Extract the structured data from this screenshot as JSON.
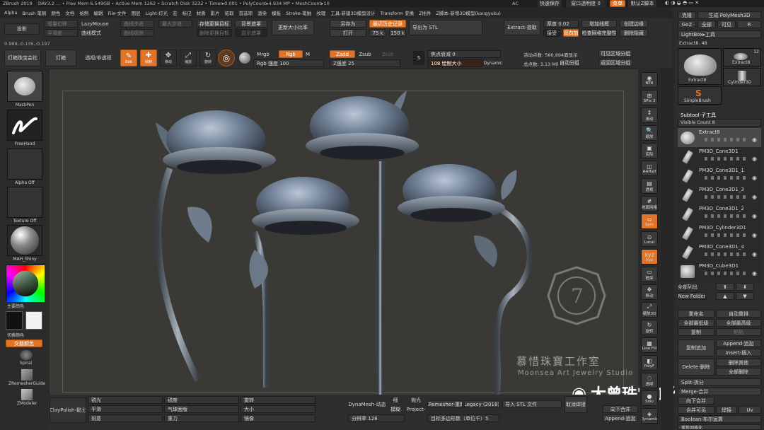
{
  "menubar": {
    "app_title": "ZBrush 2019",
    "info": "DAY3.2 … • Free Mem 6.549GB • Active Mem 1262 • Scratch Disk 3232 • Timer▸0.001 • PolyCount▸4.934 MP • MeshCount▸10",
    "ac": "AC",
    "quicksave": "快速保存",
    "transparency": "窗口透明度 0",
    "menu_btn": "菜单",
    "default_script": "默认Z脚本",
    "items": [
      "Alpha",
      "Brush 笔刷",
      "颜色",
      "文档",
      "绘制",
      "编辑",
      "File-文件",
      "图层",
      "Light-灯光",
      "宏",
      "标记",
      "材质",
      "影片",
      "拓取",
      "首选项",
      "渲染",
      "模板",
      "Stroke-笔触",
      "纹理",
      "工具-新建3D模型设计",
      "Transform 变换",
      "Z插件",
      "Z脚本-新增3D模型(kongyuku)"
    ]
  },
  "toolbar": {
    "projection": "投影",
    "lazymouse": "LazyMouse",
    "curve_mode": "曲线模式",
    "save_brush": "存储更换目标",
    "layer_mask": "背景遮罩",
    "resize": "更新大小比率",
    "save_as": "另存为",
    "open": "打开",
    "history": "最近历史记录",
    "export_stl": "导出为 STL",
    "val_75k": "75 k",
    "val_150k": "150 k",
    "extract": "Extract-提取",
    "thickness": "厚度 0.02",
    "double": "双向加",
    "accept": "接受",
    "smooth": "平滑",
    "increase_borders": "增加线框",
    "check_model": "检查网格完整性",
    "delete_hidden": "删除隐藏",
    "subdiv_edges": "创建边缘",
    "coords": "0.989,-0.135,-0.197",
    "lightbox": "灯箱珠宝会社",
    "light": "灯箱",
    "perspective": "透视/非透视",
    "edit": "Edit",
    "draw": "绘制",
    "move": "移动",
    "scale": "缩放",
    "rotate": "旋转",
    "mrgb": "Mrgb",
    "rgb": "Rgb",
    "m": "M",
    "rgb_intensity": "Rgb 强度 100",
    "zadd": "Zadd",
    "zsub": "Zsub",
    "zcut": "Zcut",
    "z_intensity": "Z强度 25",
    "focal_shift": "焦点衰减 0",
    "draw_size": "108 绘制大小",
    "dynamic": "Dynamic",
    "active_points": "活动点数: 560,894面显示",
    "total_points": "总点数: 3.13 Mil",
    "auto_groups": "自动分组",
    "visible_groups": "可见区域分组",
    "inverse": "翻转法线",
    "grow": "返回区域分组"
  },
  "leftpanel": {
    "maskpen": "MaskPen",
    "freehand": "FreeHand",
    "alpha_off": "Alpha Off",
    "texture_off": "Texture Off",
    "material": "MAH_Shiny",
    "primary_color": "主要颜色",
    "switch_color": "切换颜色",
    "alt_color": "交替颜色",
    "spiral": "Spiral",
    "zremesher": "ZRemesherGuide",
    "zmodeler": "ZModeler"
  },
  "rightstrip": {
    "items": [
      "BPR",
      "SPix 3",
      "滚动",
      "缩放",
      "实际",
      "AAHalf",
      "透视",
      "地面网格",
      "Sym",
      "Local",
      "Xyz",
      "框架",
      "移动",
      "缩放3D",
      "旋转",
      "Line Fill",
      "PolyF",
      "透明",
      "Solo",
      "Dynamic"
    ]
  },
  "rightpanel": {
    "clone": "克隆",
    "make_polymesh": "生成 PolyMesh3D",
    "goz": "GoZ",
    "all": "全部",
    "visible": "可见",
    "r": "R",
    "lightbox_tool": "LightBox▸工具",
    "extract_label": "Extract8. 48",
    "thumb1": "Extract8",
    "thumb2": "Extract8",
    "thumb3": "Cylinder3D",
    "thumb4": "SimpleBrush",
    "thumb_count": "12",
    "subtool_title": "Subtool-子工具",
    "visible_count": "Visible Count 8",
    "subtools": [
      {
        "name": "Extract8"
      },
      {
        "name": "PM3D_Cone3D1"
      },
      {
        "name": "PM3D_Cone3D1_1"
      },
      {
        "name": "PM3D_Cone3D1_3"
      },
      {
        "name": "PM3D_Cone3D1_2"
      },
      {
        "name": "PM3D_Cylinder3D1"
      },
      {
        "name": "PM3D_Cone3D1_4"
      },
      {
        "name": "PM3D_Cube3D1"
      }
    ],
    "all_list": "全部列出",
    "new_folder": "New Folder",
    "rename": "重命名",
    "auto_reorder": "自动重排",
    "all_low": "全部最低级",
    "all_high": "全部最高级",
    "copy": "复制",
    "paste": "粘贴",
    "dup_append": "复制追加",
    "append": "Append-追加",
    "insert": "Insert-插入",
    "delete": "Delete-删除",
    "del_other": "删除其他",
    "del_all": "全部删除",
    "split": "Split-拆分",
    "merge": "Merge-合并",
    "merge_down": "向下合并",
    "merge_visible": "合并可见",
    "weld": "焊接",
    "uv": "Uv",
    "boolean": "Boolean-布尔运算",
    "remesh": "重新网格化"
  },
  "bottombar": {
    "brush": "ClayPolish-黏土",
    "sharpen": "锐光",
    "flat": "平滑",
    "smooth": "刻意",
    "sharpness": "锐度",
    "magnitude": "气球面版",
    "repeat": "重力",
    "rot": "旋转",
    "size": "大小",
    "rect": "镜像",
    "dynamesh": "DynaMesh-动态",
    "resolution": "分辨率 128",
    "project": "Project-",
    "thin": "细",
    "model": "模糊",
    "polish": "抛光",
    "zremesher": "ZRemesher-重新",
    "legacy": "Legacy (2018)",
    "target": "目标多边形数（单位千）5",
    "import_stl": "导入 STL 文件",
    "unweld": "取消焊接",
    "merge_down": "向下合并",
    "append": "Append-追加"
  },
  "watermark": {
    "studio_cn": "慕惜珠寶工作室",
    "studio_en": "Moonsea Art Jewelry Studio",
    "wechat": "大曾珠宝工作室"
  },
  "colors": {
    "accent": "#e0742a",
    "bg": "#2a2a2a",
    "canvas": "#3b3a38"
  }
}
